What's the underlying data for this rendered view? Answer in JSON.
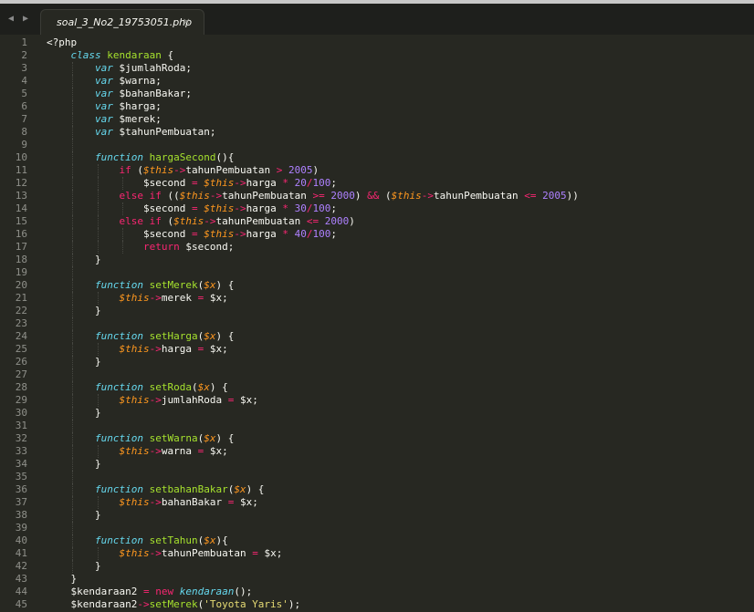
{
  "tab": {
    "title": "soal_3_No2_19753051.php",
    "close": "×",
    "prev": "◀",
    "next": "▶"
  },
  "lines": [
    [
      [
        "<?php",
        ""
      ]
    ],
    [
      [
        "    ",
        ""
      ],
      [
        "class",
        "kw"
      ],
      [
        " ",
        ""
      ],
      [
        "kendaraan",
        "cls"
      ],
      [
        " {",
        ""
      ]
    ],
    [
      [
        "        ",
        ""
      ],
      [
        "var",
        "kw"
      ],
      [
        " $jumlahRoda;",
        ""
      ]
    ],
    [
      [
        "        ",
        ""
      ],
      [
        "var",
        "kw"
      ],
      [
        " $warna;",
        ""
      ]
    ],
    [
      [
        "        ",
        ""
      ],
      [
        "var",
        "kw"
      ],
      [
        " $bahanBakar;",
        ""
      ]
    ],
    [
      [
        "        ",
        ""
      ],
      [
        "var",
        "kw"
      ],
      [
        " $harga;",
        ""
      ]
    ],
    [
      [
        "        ",
        ""
      ],
      [
        "var",
        "kw"
      ],
      [
        " $merek;",
        ""
      ]
    ],
    [
      [
        "        ",
        ""
      ],
      [
        "var",
        "kw"
      ],
      [
        " $tahunPembuatan;",
        ""
      ]
    ],
    [
      [
        "",
        ""
      ]
    ],
    [
      [
        "        ",
        ""
      ],
      [
        "function",
        "kw"
      ],
      [
        " ",
        ""
      ],
      [
        "hargaSecond",
        "fn"
      ],
      [
        "(){",
        ""
      ]
    ],
    [
      [
        "            ",
        ""
      ],
      [
        "if",
        "pink"
      ],
      [
        " (",
        ""
      ],
      [
        "$this",
        "th"
      ],
      [
        "->",
        "pink"
      ],
      [
        "tahunPembuatan ",
        ""
      ],
      [
        ">",
        "pink"
      ],
      [
        " ",
        ""
      ],
      [
        "2005",
        "num"
      ],
      [
        ")",
        ""
      ]
    ],
    [
      [
        "                $second ",
        ""
      ],
      [
        "=",
        "pink"
      ],
      [
        " ",
        ""
      ],
      [
        "$this",
        "th"
      ],
      [
        "->",
        "pink"
      ],
      [
        "harga ",
        ""
      ],
      [
        "*",
        "pink"
      ],
      [
        " ",
        ""
      ],
      [
        "20",
        "num"
      ],
      [
        "/",
        "pink"
      ],
      [
        "100",
        "num"
      ],
      [
        ";",
        ""
      ]
    ],
    [
      [
        "            ",
        ""
      ],
      [
        "else",
        "pink"
      ],
      [
        " ",
        ""
      ],
      [
        "if",
        "pink"
      ],
      [
        " ((",
        ""
      ],
      [
        "$this",
        "th"
      ],
      [
        "->",
        "pink"
      ],
      [
        "tahunPembuatan ",
        ""
      ],
      [
        ">=",
        "pink"
      ],
      [
        " ",
        ""
      ],
      [
        "2000",
        "num"
      ],
      [
        ") ",
        ""
      ],
      [
        "&&",
        "pink"
      ],
      [
        " (",
        ""
      ],
      [
        "$this",
        "th"
      ],
      [
        "->",
        "pink"
      ],
      [
        "tahunPembuatan ",
        ""
      ],
      [
        "<=",
        "pink"
      ],
      [
        " ",
        ""
      ],
      [
        "2005",
        "num"
      ],
      [
        "))",
        ""
      ]
    ],
    [
      [
        "                $second ",
        ""
      ],
      [
        "=",
        "pink"
      ],
      [
        " ",
        ""
      ],
      [
        "$this",
        "th"
      ],
      [
        "->",
        "pink"
      ],
      [
        "harga ",
        ""
      ],
      [
        "*",
        "pink"
      ],
      [
        " ",
        ""
      ],
      [
        "30",
        "num"
      ],
      [
        "/",
        "pink"
      ],
      [
        "100",
        "num"
      ],
      [
        ";",
        ""
      ]
    ],
    [
      [
        "            ",
        ""
      ],
      [
        "else",
        "pink"
      ],
      [
        " ",
        ""
      ],
      [
        "if",
        "pink"
      ],
      [
        " (",
        ""
      ],
      [
        "$this",
        "th"
      ],
      [
        "->",
        "pink"
      ],
      [
        "tahunPembuatan ",
        ""
      ],
      [
        "<=",
        "pink"
      ],
      [
        " ",
        ""
      ],
      [
        "2000",
        "num"
      ],
      [
        ")",
        ""
      ]
    ],
    [
      [
        "                $second ",
        ""
      ],
      [
        "=",
        "pink"
      ],
      [
        " ",
        ""
      ],
      [
        "$this",
        "th"
      ],
      [
        "->",
        "pink"
      ],
      [
        "harga ",
        ""
      ],
      [
        "*",
        "pink"
      ],
      [
        " ",
        ""
      ],
      [
        "40",
        "num"
      ],
      [
        "/",
        "pink"
      ],
      [
        "100",
        "num"
      ],
      [
        ";",
        ""
      ]
    ],
    [
      [
        "                ",
        ""
      ],
      [
        "return",
        "pink"
      ],
      [
        " $second;",
        ""
      ]
    ],
    [
      [
        "        }",
        ""
      ]
    ],
    [
      [
        "",
        ""
      ]
    ],
    [
      [
        "        ",
        ""
      ],
      [
        "function",
        "kw"
      ],
      [
        " ",
        ""
      ],
      [
        "setMerek",
        "fn"
      ],
      [
        "(",
        ""
      ],
      [
        "$x",
        "th"
      ],
      [
        ") {",
        ""
      ]
    ],
    [
      [
        "            ",
        ""
      ],
      [
        "$this",
        "th"
      ],
      [
        "->",
        "pink"
      ],
      [
        "merek ",
        ""
      ],
      [
        "=",
        "pink"
      ],
      [
        " $x;",
        ""
      ]
    ],
    [
      [
        "        }",
        ""
      ]
    ],
    [
      [
        "",
        ""
      ]
    ],
    [
      [
        "        ",
        ""
      ],
      [
        "function",
        "kw"
      ],
      [
        " ",
        ""
      ],
      [
        "setHarga",
        "fn"
      ],
      [
        "(",
        ""
      ],
      [
        "$x",
        "th"
      ],
      [
        ") {",
        ""
      ]
    ],
    [
      [
        "            ",
        ""
      ],
      [
        "$this",
        "th"
      ],
      [
        "->",
        "pink"
      ],
      [
        "harga ",
        ""
      ],
      [
        "=",
        "pink"
      ],
      [
        " $x;",
        ""
      ]
    ],
    [
      [
        "        }",
        ""
      ]
    ],
    [
      [
        "",
        ""
      ]
    ],
    [
      [
        "        ",
        ""
      ],
      [
        "function",
        "kw"
      ],
      [
        " ",
        ""
      ],
      [
        "setRoda",
        "fn"
      ],
      [
        "(",
        ""
      ],
      [
        "$x",
        "th"
      ],
      [
        ") {",
        ""
      ]
    ],
    [
      [
        "            ",
        ""
      ],
      [
        "$this",
        "th"
      ],
      [
        "->",
        "pink"
      ],
      [
        "jumlahRoda ",
        ""
      ],
      [
        "=",
        "pink"
      ],
      [
        " $x;",
        ""
      ]
    ],
    [
      [
        "        }",
        ""
      ]
    ],
    [
      [
        "",
        ""
      ]
    ],
    [
      [
        "        ",
        ""
      ],
      [
        "function",
        "kw"
      ],
      [
        " ",
        ""
      ],
      [
        "setWarna",
        "fn"
      ],
      [
        "(",
        ""
      ],
      [
        "$x",
        "th"
      ],
      [
        ") {",
        ""
      ]
    ],
    [
      [
        "            ",
        ""
      ],
      [
        "$this",
        "th"
      ],
      [
        "->",
        "pink"
      ],
      [
        "warna ",
        ""
      ],
      [
        "=",
        "pink"
      ],
      [
        " $x;",
        ""
      ]
    ],
    [
      [
        "        }",
        ""
      ]
    ],
    [
      [
        "",
        ""
      ]
    ],
    [
      [
        "        ",
        ""
      ],
      [
        "function",
        "kw"
      ],
      [
        " ",
        ""
      ],
      [
        "setbahanBakar",
        "fn"
      ],
      [
        "(",
        ""
      ],
      [
        "$x",
        "th"
      ],
      [
        ") {",
        ""
      ]
    ],
    [
      [
        "            ",
        ""
      ],
      [
        "$this",
        "th"
      ],
      [
        "->",
        "pink"
      ],
      [
        "bahanBakar ",
        ""
      ],
      [
        "=",
        "pink"
      ],
      [
        " $x;",
        ""
      ]
    ],
    [
      [
        "        }",
        ""
      ]
    ],
    [
      [
        "",
        ""
      ]
    ],
    [
      [
        "        ",
        ""
      ],
      [
        "function",
        "kw"
      ],
      [
        " ",
        ""
      ],
      [
        "setTahun",
        "fn"
      ],
      [
        "(",
        ""
      ],
      [
        "$x",
        "th"
      ],
      [
        "){",
        ""
      ]
    ],
    [
      [
        "            ",
        ""
      ],
      [
        "$this",
        "th"
      ],
      [
        "->",
        "pink"
      ],
      [
        "tahunPembuatan ",
        ""
      ],
      [
        "=",
        "pink"
      ],
      [
        " $x;",
        ""
      ]
    ],
    [
      [
        "        }",
        ""
      ]
    ],
    [
      [
        "    }",
        ""
      ]
    ],
    [
      [
        "    $kendaraan2 ",
        ""
      ],
      [
        "=",
        "pink"
      ],
      [
        " ",
        ""
      ],
      [
        "new",
        "pink"
      ],
      [
        " ",
        ""
      ],
      [
        "kendaraan",
        "kw"
      ],
      [
        "();",
        ""
      ]
    ],
    [
      [
        "    $kendaraan2",
        ""
      ],
      [
        "->",
        "pink"
      ],
      [
        "setMerek",
        "fn"
      ],
      [
        "(",
        ""
      ],
      [
        "'Toyota Yaris'",
        "str"
      ],
      [
        ");",
        ""
      ]
    ]
  ],
  "colors": {
    "background": "#272822",
    "keyword": "#66d9ef",
    "operator": "#f92672",
    "function": "#a6e22e",
    "number": "#ae81ff",
    "this": "#fd971f",
    "string": "#e6db74"
  }
}
